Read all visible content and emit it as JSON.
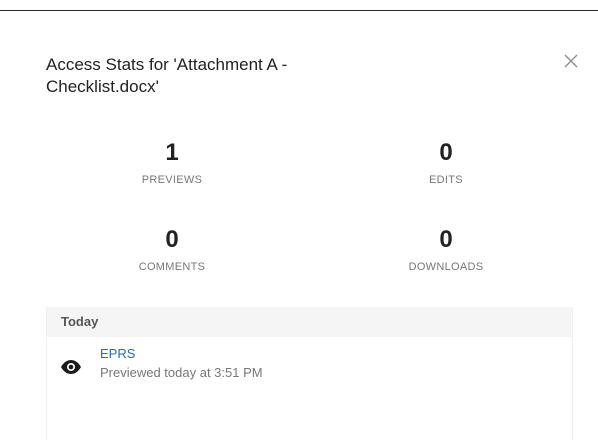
{
  "dialog": {
    "title": "Access Stats for 'Attachment A - Checklist.docx'",
    "close_icon": "close-icon"
  },
  "stats": [
    {
      "value": "1",
      "label": "PREVIEWS"
    },
    {
      "value": "0",
      "label": "EDITS"
    },
    {
      "value": "0",
      "label": "COMMENTS"
    },
    {
      "value": "0",
      "label": "DOWNLOADS"
    }
  ],
  "activity": {
    "day_label": "Today",
    "events": [
      {
        "icon": "eye-icon",
        "user": "EPRS",
        "description": "Previewed today at 3:51 PM"
      }
    ]
  },
  "colors": {
    "link": "#1a6fc4",
    "muted": "#777777",
    "header_bg": "#f5f5f5"
  }
}
